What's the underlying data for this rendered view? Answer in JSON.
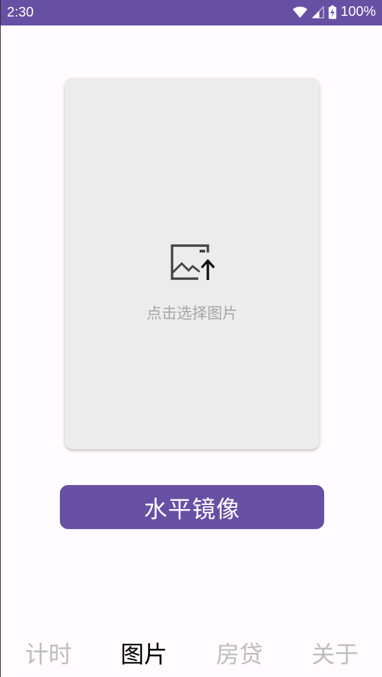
{
  "status_bar": {
    "time": "2:30",
    "battery": "100%",
    "icons": [
      "wifi-icon",
      "signal-icon",
      "battery-charging-icon"
    ]
  },
  "image_picker": {
    "icon": "image-upload-icon",
    "prompt": "点击选择图片"
  },
  "action": {
    "label": "水平镜像"
  },
  "bottom_nav": {
    "tabs": [
      {
        "label": "计时",
        "active": false
      },
      {
        "label": "图片",
        "active": true
      },
      {
        "label": "房贷",
        "active": false
      },
      {
        "label": "关于",
        "active": false
      }
    ]
  },
  "colors": {
    "primary": "#6750A4",
    "background": "#FFFBFE",
    "card": "#ECECEC",
    "hint_text": "#A6A6A6",
    "inactive_tab": "#BDBDBD",
    "active_tab": "#000000"
  }
}
